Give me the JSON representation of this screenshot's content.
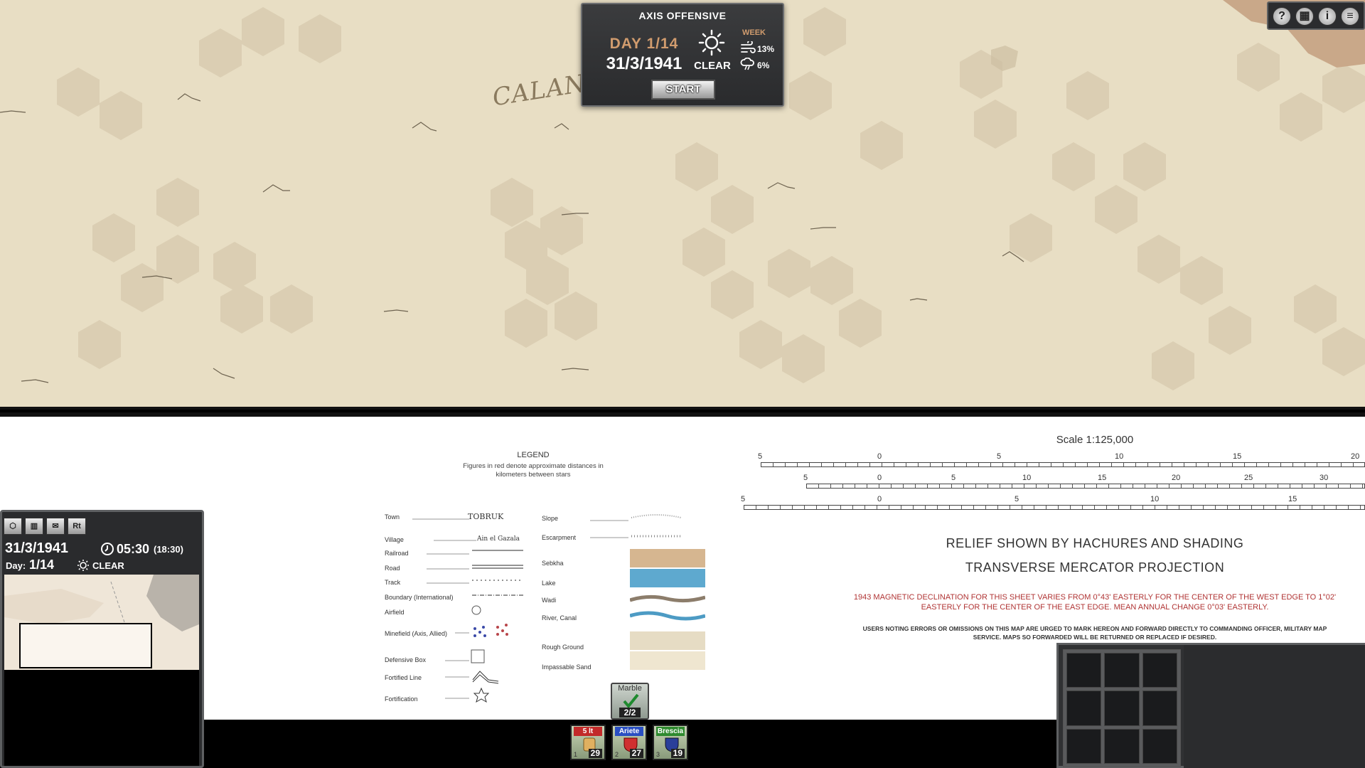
{
  "map": {
    "place_name": "CALANSH"
  },
  "turn_panel": {
    "title": "AXIS OFFENSIVE",
    "day": "DAY 1/14",
    "date": "31/3/1941",
    "weather": "CLEAR",
    "week_label": "WEEK",
    "wind_chance": "13%",
    "rain_chance": "6%",
    "start_label": "START"
  },
  "top_buttons": {
    "help": "?",
    "book": "▦",
    "info": "i",
    "menu": "≡"
  },
  "legend": {
    "title": "LEGEND",
    "note": "Figures in red denote approximate distances in kilometers between stars",
    "town_sample": "TOBRUK",
    "village_sample": "Ain el Gazala",
    "left_items": [
      "Town",
      "Village",
      "Railroad",
      "Road",
      "Track",
      "Boundary (International)",
      "Airfield",
      "Minefield (Axis, Allied)",
      "Defensive Box",
      "Fortified Line",
      "Fortification"
    ],
    "right_items": [
      "Slope",
      "Escarpment",
      "Sebkha",
      "Lake",
      "Wadi",
      "River, Canal",
      "Rough Ground",
      "Impassable Sand"
    ]
  },
  "scale": {
    "title": "Scale 1:125,000",
    "row1": [
      "5",
      "0",
      "5",
      "10",
      "15",
      "20"
    ],
    "row2": [
      "5",
      "0",
      "5",
      "10",
      "15",
      "20",
      "25",
      "30"
    ],
    "row3": [
      "5",
      "0",
      "5",
      "10",
      "15"
    ]
  },
  "sheet_text": {
    "relief": "RELIEF SHOWN BY HACHURES AND SHADING",
    "projection": "TRANSVERSE MERCATOR PROJECTION",
    "declination": "1943 MAGNETIC DECLINATION FOR THIS SHEET VARIES FROM 0°43' EASTERLY FOR THE CENTER OF THE WEST EDGE TO 1°02' EASTERLY FOR THE CENTER OF THE EAST EDGE. MEAN ANNUAL CHANGE 0°03' EASTERLY.",
    "users_note": "USERS NOTING ERRORS OR OMISSIONS ON THIS MAP ARE URGED TO MARK HEREON AND FORWARD DIRECTLY TO COMMANDING OFFICER, MILITARY MAP SERVICE. MAPS SO FORWARDED WILL BE RETURNED OR REPLACED IF DESIRED."
  },
  "marble": {
    "label": "Marble",
    "count": "2/2"
  },
  "units": [
    {
      "name": "5 lt",
      "index": "1",
      "strength": "29",
      "color": "#c22a2a"
    },
    {
      "name": "Ariete",
      "index": "2",
      "strength": "27",
      "color": "#2a4fc2"
    },
    {
      "name": "Brescia",
      "index": "3",
      "strength": "19",
      "color": "#2f8a2f"
    }
  ],
  "overview": {
    "tools": [
      "⬡",
      "▥",
      "✉",
      "Rt"
    ],
    "date": "31/3/1941",
    "time": "05:30",
    "time_sub": "(18:30)",
    "day_label": "Day:",
    "day_value": "1/14",
    "weather": "CLEAR"
  },
  "colors": {
    "map_sand": "#e8dec4",
    "hex_shade": "#d8ccb0",
    "panel_dark": "#2a2b2d",
    "accent_orange": "#d19c6e",
    "declination_red": "#b03434"
  }
}
